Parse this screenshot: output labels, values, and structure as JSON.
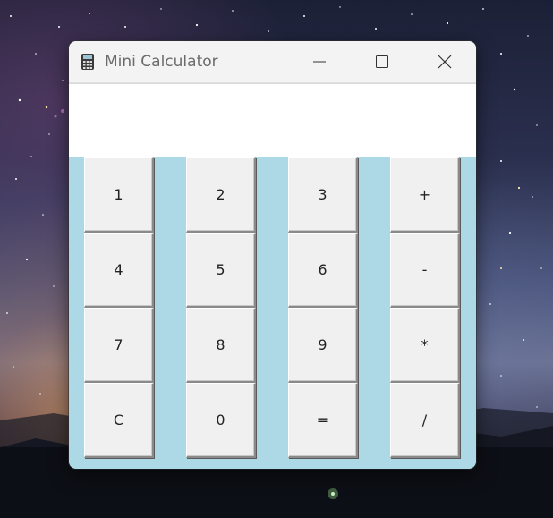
{
  "window": {
    "title": "Mini Calculator",
    "icon": "calculator-icon",
    "controls": [
      "minimize-icon",
      "maximize-icon",
      "close-icon"
    ]
  },
  "display": {
    "value": ""
  },
  "keypad": {
    "rows": [
      [
        "1",
        "2",
        "3",
        "+"
      ],
      [
        "4",
        "5",
        "6",
        "-"
      ],
      [
        "7",
        "8",
        "9",
        "*"
      ],
      [
        "C",
        "0",
        "=",
        "/"
      ]
    ]
  },
  "colors": {
    "keypad_background": "#add8e6",
    "display_background": "#ffffff",
    "key_background": "#f0f0f0",
    "titlebar_background": "#f3f3f3"
  }
}
